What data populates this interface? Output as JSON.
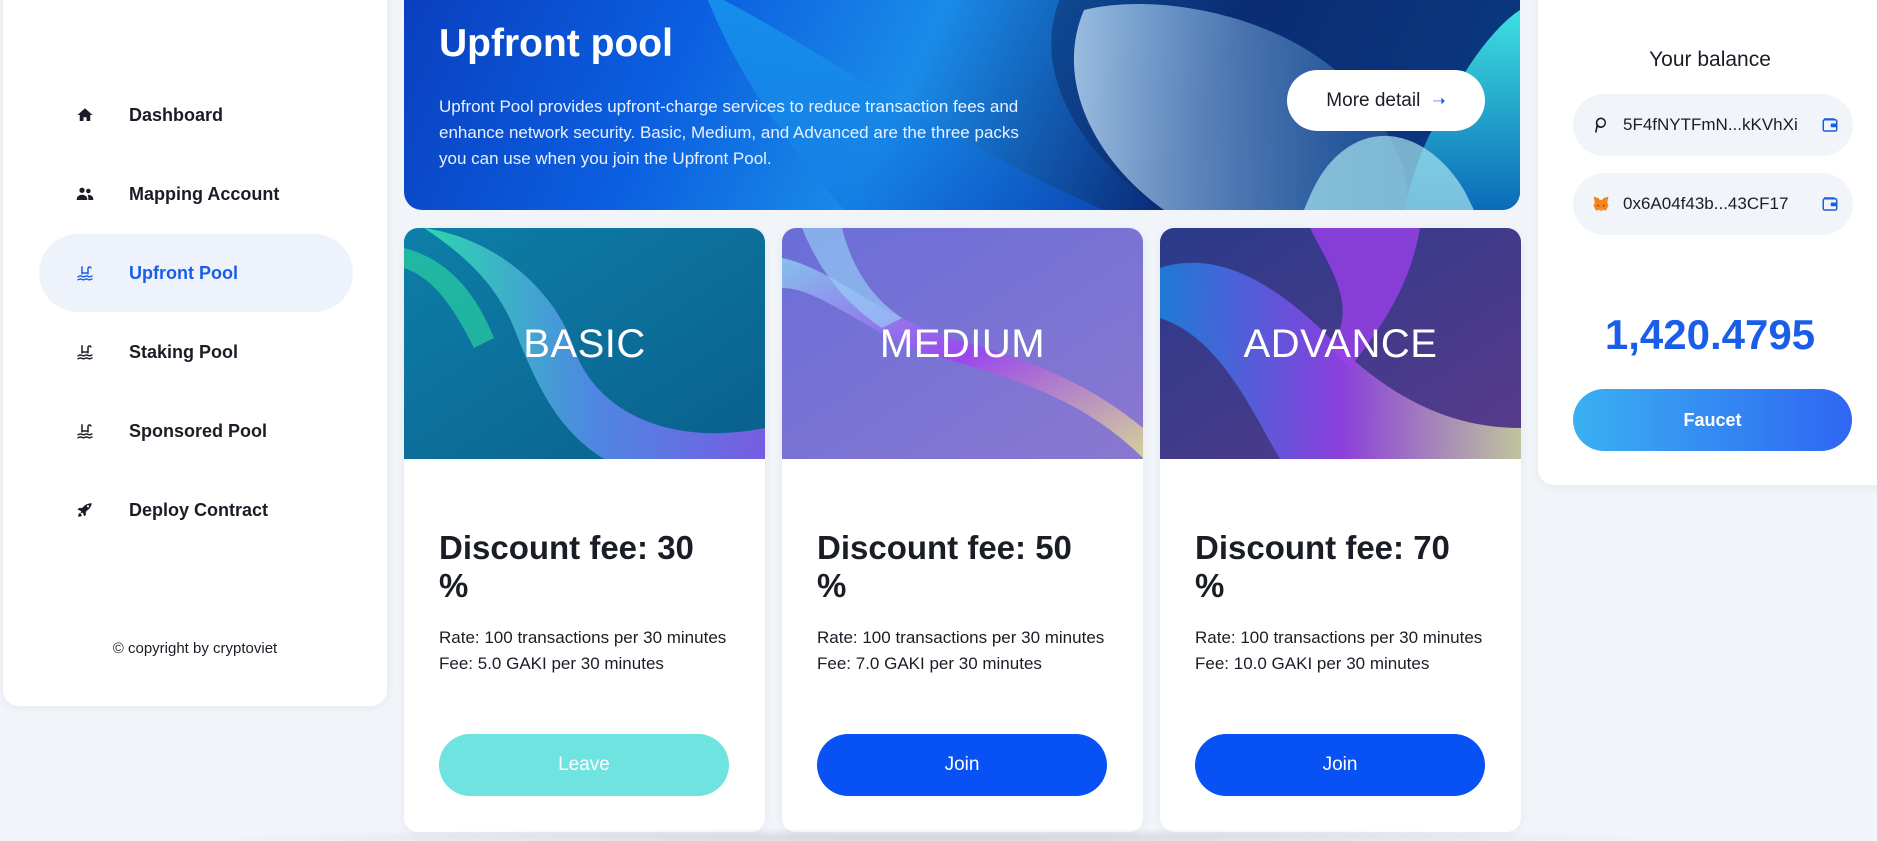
{
  "sidebar": {
    "items": [
      {
        "label": "Dashboard",
        "icon": "home-icon"
      },
      {
        "label": "Mapping Account",
        "icon": "users-icon"
      },
      {
        "label": "Upfront Pool",
        "icon": "pool-icon",
        "active": true
      },
      {
        "label": "Staking Pool",
        "icon": "pool-icon"
      },
      {
        "label": "Sponsored Pool",
        "icon": "pool-icon"
      },
      {
        "label": "Deploy Contract",
        "icon": "rocket-icon"
      }
    ],
    "copyright": "© copyright by cryptoviet"
  },
  "hero": {
    "title": "Upfront pool",
    "description": "Upfront Pool provides upfront-charge services to reduce transaction fees and enhance network security. Basic, Medium, and Advanced are the three packs you can use when you join the Upfront Pool.",
    "button_label": "More detail",
    "button_icon": "arrow-right-icon"
  },
  "packs": [
    {
      "name": "BASIC",
      "discount": "Discount fee: 30 %",
      "rate": "Rate: 100 transactions per 30 minutes",
      "fee": "Fee: 5.0 GAKI per 30 minutes",
      "button": "Leave"
    },
    {
      "name": "MEDIUM",
      "discount": "Discount fee: 50 %",
      "rate": "Rate: 100 transactions per 30 minutes",
      "fee": "Fee: 7.0 GAKI per 30 minutes",
      "button": "Join"
    },
    {
      "name": "ADVANCE",
      "discount": "Discount fee: 70 %",
      "rate": "Rate: 100 transactions per 30 minutes",
      "fee": "Fee: 10.0 GAKI per 30 minutes",
      "button": "Join"
    }
  ],
  "balance": {
    "title": "Your balance",
    "substrate_address": "5F4fNYTFmN...kKVhXi",
    "evm_address": "0x6A04f43b...43CF17",
    "amount": "1,420.4795",
    "faucet_label": "Faucet"
  },
  "colors": {
    "accent": "#1a5de8",
    "join_button": "#0751f5",
    "leave_button": "#6fe3e0",
    "page_background": "#f1f4f9"
  }
}
